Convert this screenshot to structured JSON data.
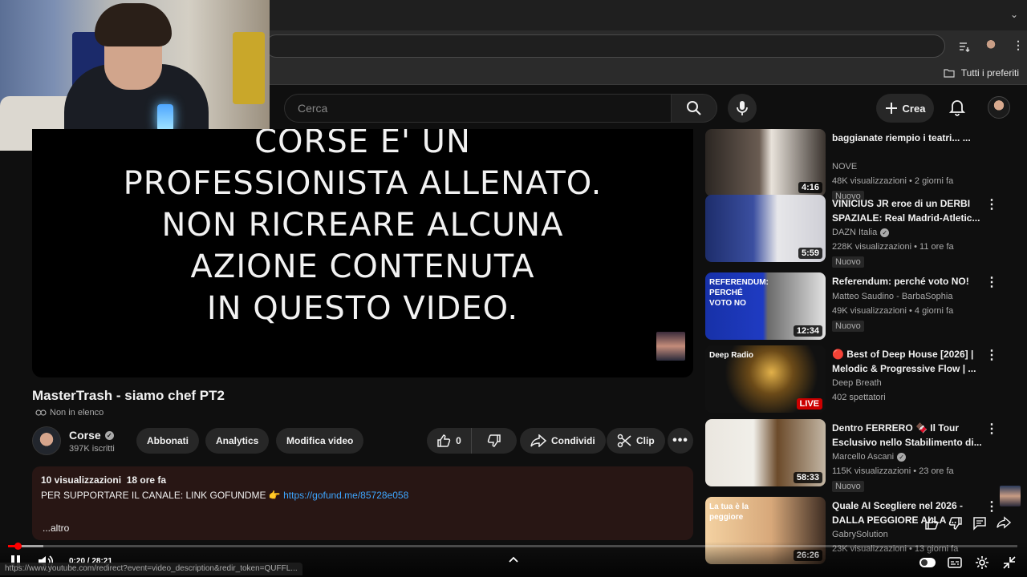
{
  "browser": {
    "bookmarks_label": "Tutti i preferiti"
  },
  "header": {
    "search_placeholder": "Cerca",
    "create_label": "Crea"
  },
  "player": {
    "warning_lines": [
      "CORSE E' UN",
      "PROFESSIONISTA ALLENATO.",
      "NON RICREARE ALCUNA",
      "AZIONE CONTENUTA",
      "IN QUESTO VIDEO."
    ],
    "progress_fraction": 0.0118
  },
  "video": {
    "title": "MasterTrash - siamo chef PT2",
    "visibility": "Non in elenco",
    "channel_name": "Corse",
    "subscribers": "397K iscritti",
    "buttons": {
      "subscribe": "Abbonati",
      "analytics": "Analytics",
      "edit": "Modifica video",
      "likes": "0",
      "share": "Condividi",
      "clip": "Clip"
    },
    "description": {
      "meta": "10 visualizzazioni  18 ore fa",
      "text": "PER SUPPORTARE IL CANALE: LINK GOFUNDME 👉 ",
      "link": "https://gofund.me/85728e058",
      "more": "...altro"
    }
  },
  "recommendations": [
    {
      "title": "baggianate riempio i teatri... ...",
      "channel": "NOVE",
      "verified": false,
      "views": "48K visualizzazioni • 2 giorni fa",
      "badge": "Nuovo",
      "duration": "4:16",
      "live": false
    },
    {
      "title": "VINICIUS JR eroe di un DERBI SPAZIALE: Real Madrid-Atletic...",
      "channel": "DAZN Italia",
      "verified": true,
      "views": "228K visualizzazioni • 11 ore fa",
      "badge": "Nuovo",
      "duration": "5:59",
      "live": false
    },
    {
      "title": "Referendum: perché voto NO!",
      "channel": "Matteo Saudino - BarbaSophia",
      "verified": false,
      "views": "49K visualizzazioni • 4 giorni fa",
      "badge": "Nuovo",
      "duration": "12:34",
      "live": false,
      "thumb_text": "REFERENDUM: PERCHÉ VOTO NO"
    },
    {
      "title": "🔴 Best of Deep House [2026] | Melodic & Progressive Flow | ...",
      "channel": "Deep Breath",
      "verified": false,
      "views": "402 spettatori",
      "badge": "",
      "duration": "LIVE",
      "live": true,
      "thumb_text": "Deep Radio"
    },
    {
      "title": "Dentro FERRERO 🍫 Il Tour Esclusivo nello Stabilimento di...",
      "channel": "Marcello Ascani",
      "verified": true,
      "views": "115K visualizzazioni • 23 ore fa",
      "badge": "Nuovo",
      "duration": "58:33",
      "live": false
    },
    {
      "title": "Quale AI Scegliere nel 2026 - DALLA PEGGIORE ALLA ...",
      "channel": "GabrySolution",
      "verified": false,
      "views": "23K visualizzazioni • 13 giorni fa",
      "badge": "",
      "duration": "26:26",
      "live": false,
      "thumb_text": "La tua è la peggiore"
    }
  ],
  "controls": {
    "time": "0:20 / 28:21",
    "status_url": "https://www.youtube.com/redirect?event=video_description&redir_token=QUFFL..."
  },
  "colors": {
    "accent_red": "#ff0000",
    "link_blue": "#3ea6ff",
    "description_bg": "#281614"
  }
}
